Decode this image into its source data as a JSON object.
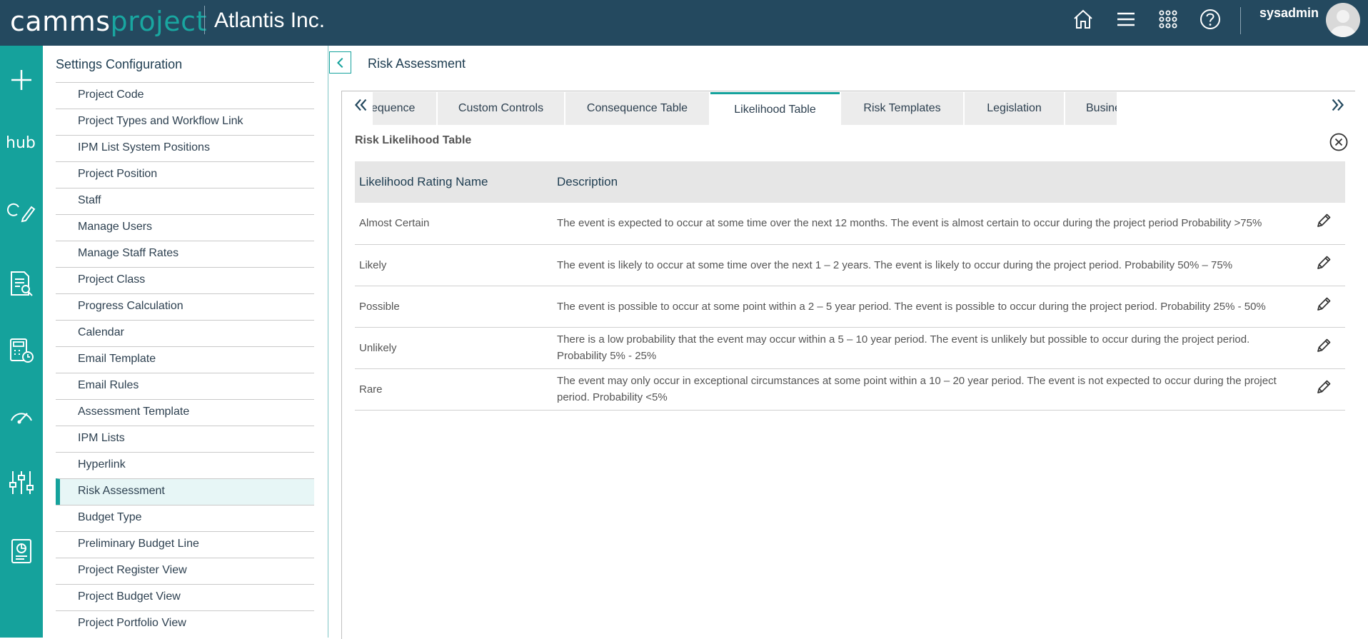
{
  "header": {
    "logo_a": "camms",
    "logo_b": "project",
    "company": "Atlantis Inc.",
    "username": "sysadmin",
    "icons": [
      "home-icon",
      "menu-icon",
      "apps-grid-icon",
      "help-icon"
    ]
  },
  "rail": {
    "hub_label": "hub",
    "icons": [
      "plus-icon",
      "hub-icon",
      "edit-cycle-icon",
      "document-search-icon",
      "calculator-clock-icon",
      "gauge-icon",
      "sliders-icon",
      "report-icon"
    ]
  },
  "settings": {
    "title": "Settings Configuration",
    "items": [
      "Project Code",
      "Project Types and Workflow Link",
      "IPM List System Positions",
      "Project Position",
      "Staff",
      "Manage Users",
      "Manage Staff Rates",
      "Project Class",
      "Progress Calculation",
      "Calendar",
      "Email Template",
      "Email Rules",
      "Assessment Template",
      "IPM Lists",
      "Hyperlink",
      "Risk Assessment",
      "Budget Type",
      "Preliminary Budget Line",
      "Project Register View",
      "Project Budget View",
      "Project Portfolio View"
    ],
    "active_item": "Risk Assessment"
  },
  "main": {
    "title": "Risk Assessment",
    "tabs": [
      "equence",
      "Custom Controls",
      "Consequence Table",
      "Likelihood Table",
      "Risk Templates",
      "Legislation",
      "Business Process"
    ],
    "active_tab": "Likelihood Table",
    "table_title": "Risk Likelihood Table",
    "columns": [
      "Likelihood Rating Name",
      "Description"
    ],
    "rows": [
      {
        "name": "Almost Certain",
        "description": "The event is expected to occur at some time over the next 12 months. The event is almost certain to occur during the project period Probability >75%"
      },
      {
        "name": "Likely",
        "description": "The event is likely to occur at some time over the next 1 – 2 years. The event is likely to occur during the project period. Probability 50% – 75%"
      },
      {
        "name": "Possible",
        "description": "The event is possible to occur at some point within a 2 – 5 year period. The event is possible to occur during the project period. Probability 25% - 50%"
      },
      {
        "name": "Unlikely",
        "description": "There is a low probability that the event may occur within a 5 – 10 year period. The event is unlikely but possible to occur during the project period. Probability 5% - 25%"
      },
      {
        "name": "Rare",
        "description": "The event may only occur in exceptional circumstances at some point within a 10 – 20 year period. The event is not expected to occur during the project period. Probability <5%"
      }
    ]
  },
  "colors": {
    "header_bg": "#24495f",
    "accent": "#15a29c",
    "tab_bg": "#ececec"
  }
}
